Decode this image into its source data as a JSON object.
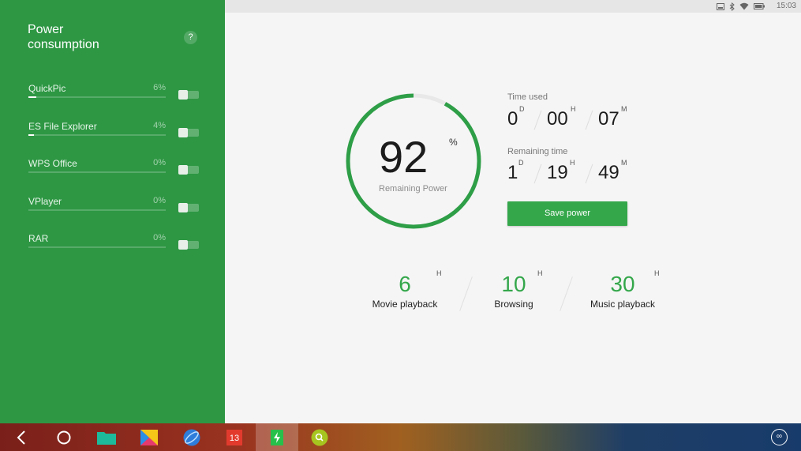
{
  "sidebar": {
    "title": "Power consumption",
    "help_label": "?",
    "apps": [
      {
        "name": "QuickPic",
        "percent": "6%",
        "usage_fraction": 0.06
      },
      {
        "name": "ES File Explorer",
        "percent": "4%",
        "usage_fraction": 0.04
      },
      {
        "name": "WPS Office",
        "percent": "0%",
        "usage_fraction": 0
      },
      {
        "name": "VPlayer",
        "percent": "0%",
        "usage_fraction": 0
      },
      {
        "name": "RAR",
        "percent": "0%",
        "usage_fraction": 0
      }
    ]
  },
  "status_bar": {
    "time": "15:03",
    "icons": [
      "screen-icon",
      "bluetooth-icon",
      "wifi-icon",
      "battery-icon"
    ]
  },
  "gauge": {
    "value": "92",
    "unit": "%",
    "label": "Remaining Power",
    "fraction": 0.92,
    "color": "#2e9e47",
    "track_color": "#e8e8e8"
  },
  "time_used": {
    "label": "Time used",
    "days": "0",
    "days_unit": "D",
    "hours": "00",
    "hours_unit": "H",
    "minutes": "07",
    "minutes_unit": "M"
  },
  "remaining_time": {
    "label": "Remaining time",
    "days": "1",
    "days_unit": "D",
    "hours": "19",
    "hours_unit": "H",
    "minutes": "49",
    "minutes_unit": "M"
  },
  "save_button": "Save power",
  "estimates": [
    {
      "value": "6",
      "unit": "H",
      "label": "Movie playback"
    },
    {
      "value": "10",
      "unit": "H",
      "label": "Browsing"
    },
    {
      "value": "30",
      "unit": "H",
      "label": "Music playback"
    }
  ],
  "taskbar": {
    "calendar_day": "13",
    "icons": [
      "back-icon",
      "home-icon",
      "folder-icon",
      "store-icon",
      "browser-icon",
      "calendar-icon",
      "battery-app-icon",
      "search-app-icon",
      "launcher-icon"
    ]
  },
  "colors": {
    "sidebar": "#2e9744",
    "accent": "#34a74b"
  }
}
